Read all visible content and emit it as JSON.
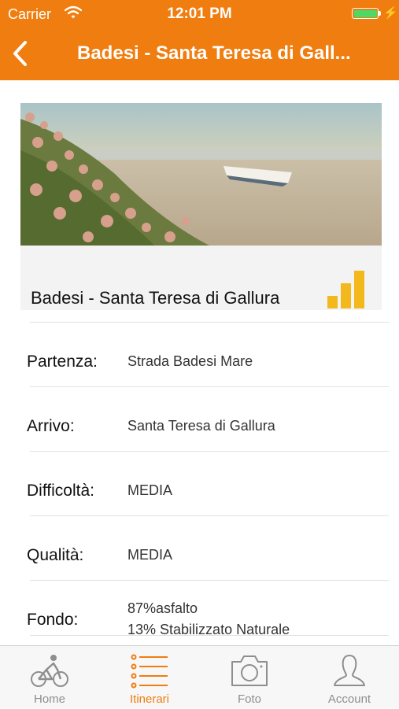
{
  "status_bar": {
    "carrier": "Carrier",
    "time": "12:01 PM"
  },
  "nav": {
    "title": "Badesi - Santa Teresa di Gall..."
  },
  "route": {
    "name": "Badesi - Santa Teresa di Gallura",
    "difficulty_bars_filled": 3
  },
  "details": {
    "departure_label": "Partenza:",
    "departure_value": "Strada Badesi Mare",
    "arrival_label": "Arrivo:",
    "arrival_value": "Santa Teresa di Gallura",
    "difficulty_label": "Difficoltà:",
    "difficulty_value": "MEDIA",
    "quality_label": "Qualità:",
    "quality_value": "MEDIA",
    "surface_label": "Fondo:",
    "surface_value_1": "87%asfalto",
    "surface_value_2": "13% Stabilizzato Naturale"
  },
  "tabs": [
    {
      "label": "Home",
      "icon": "cyclist-icon"
    },
    {
      "label": "Itinerari",
      "icon": "list-icon"
    },
    {
      "label": "Foto",
      "icon": "camera-icon"
    },
    {
      "label": "Account",
      "icon": "user-icon"
    }
  ],
  "colors": {
    "accent": "#f07d10",
    "bars": "#f2b81c",
    "battery": "#4cd964",
    "tab_inactive": "#8e8e8e"
  }
}
